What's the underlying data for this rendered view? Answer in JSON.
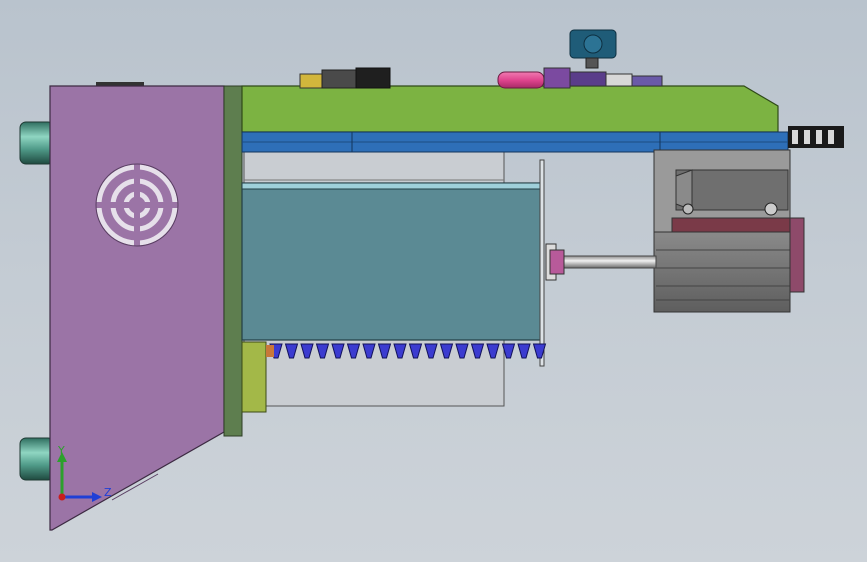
{
  "viewport": {
    "triad": {
      "y_label": "Y",
      "z_label": "Z",
      "y_color": "#2ca02c",
      "z_color": "#1f3fd6",
      "origin_color": "#c81e1e"
    }
  },
  "colors": {
    "background_top": "#b9c3cd",
    "side_plate": "#9b74a6",
    "top_plate": "#7cb342",
    "blue_rail": "#2e6fb8",
    "housing": "#5b8a94",
    "motor_block": "#707070",
    "pink_fitting": "#e0458f",
    "gauge": "#1f5c78",
    "cylinder": "#4f9a88"
  },
  "components": [
    "side-plate-purple",
    "top-plate-green",
    "blue-guide-rail",
    "main-housing-teal",
    "motor-assembly",
    "drive-shaft",
    "pressure-gauge",
    "pneumatic-fittings",
    "cable-drag-chain",
    "mounting-cylinders"
  ]
}
